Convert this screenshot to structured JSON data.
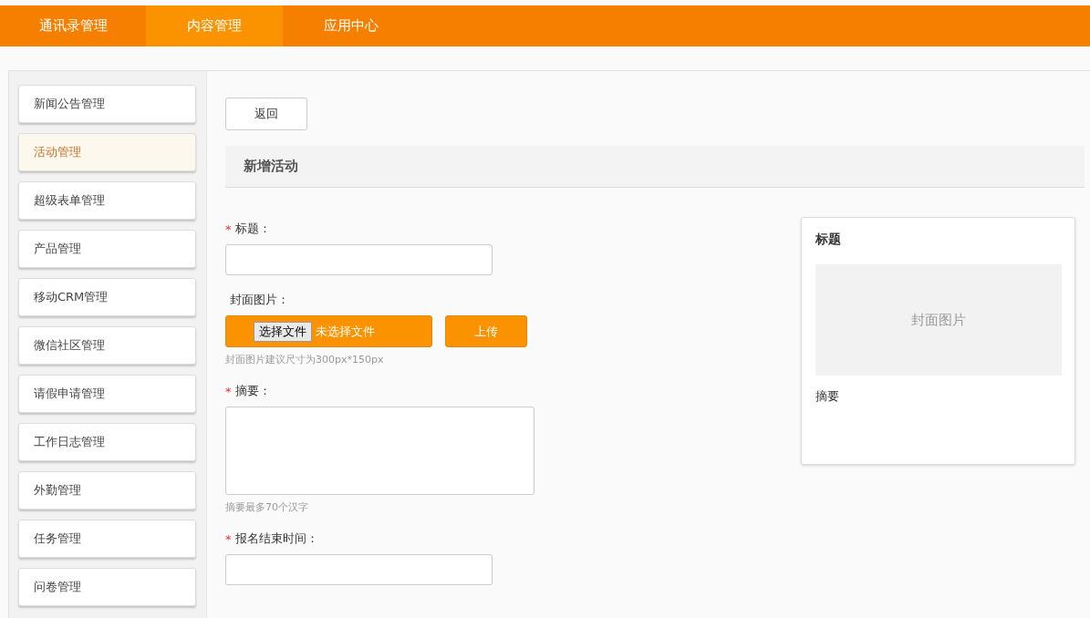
{
  "nav": {
    "tabs": [
      {
        "label": "通讯录管理",
        "selected": false
      },
      {
        "label": "内容管理",
        "selected": true
      },
      {
        "label": "应用中心",
        "selected": false
      }
    ]
  },
  "sidebar": {
    "items": [
      {
        "label": "新闻公告管理",
        "selected": false
      },
      {
        "label": "活动管理",
        "selected": true
      },
      {
        "label": "超级表单管理",
        "selected": false
      },
      {
        "label": "产品管理",
        "selected": false
      },
      {
        "label": "移动CRM管理",
        "selected": false
      },
      {
        "label": "微信社区管理",
        "selected": false
      },
      {
        "label": "请假申请管理",
        "selected": false
      },
      {
        "label": "工作日志管理",
        "selected": false
      },
      {
        "label": "外勤管理",
        "selected": false
      },
      {
        "label": "任务管理",
        "selected": false
      },
      {
        "label": "问卷管理",
        "selected": false
      }
    ]
  },
  "back_button": "返回",
  "section_title": "新增活动",
  "form": {
    "fields": [
      {
        "kind": "text",
        "label": "标题：",
        "required_mark": "*"
      },
      {
        "kind": "file",
        "label": "封面图片：",
        "choose_button": "选择文件",
        "file_status": "未选择文件",
        "upload_button": "上传",
        "hint": "封面图片建议尺寸为300px*150px"
      },
      {
        "kind": "textarea",
        "label": "摘要：",
        "required_mark": "*",
        "hint": "摘要最多70个汉字"
      },
      {
        "kind": "text",
        "label": "报名结束时间：",
        "required_mark": "*"
      }
    ]
  },
  "preview": {
    "title": "标题",
    "image_placeholder": "封面图片",
    "summary": "摘要"
  }
}
